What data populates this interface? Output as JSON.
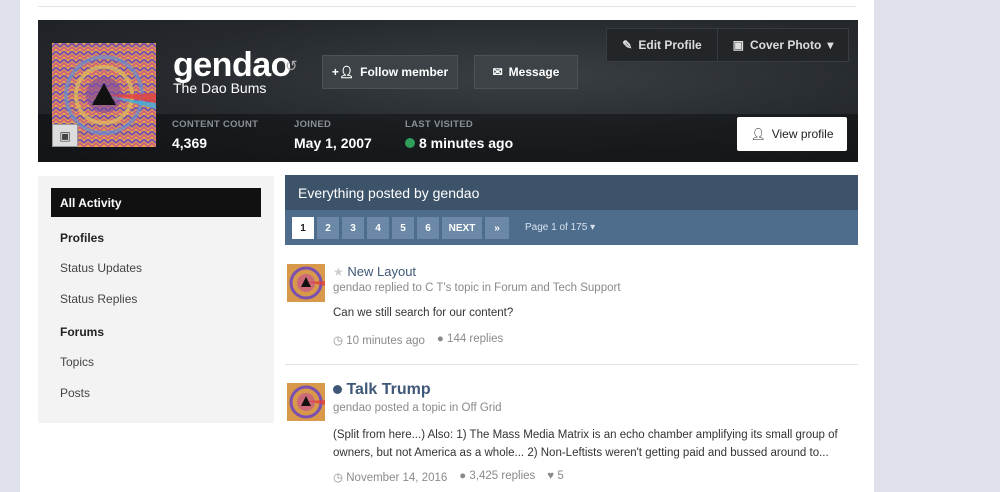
{
  "profile": {
    "username": "gendao",
    "group": "The Dao Bums",
    "follow_label": "Follow member",
    "message_label": "Message",
    "edit_profile_label": "Edit Profile",
    "cover_photo_label": "Cover Photo",
    "view_profile_label": "View profile",
    "stats": [
      {
        "label": "CONTENT COUNT",
        "value": "4,369"
      },
      {
        "label": "JOINED",
        "value": "May 1, 2007"
      },
      {
        "label": "LAST VISITED",
        "value": "8 minutes ago"
      }
    ]
  },
  "sidebar": {
    "active": "All Activity",
    "profiles_heading": "Profiles",
    "profiles_items": [
      "Status Updates",
      "Status Replies"
    ],
    "forums_heading": "Forums",
    "forums_items": [
      "Topics",
      "Posts"
    ]
  },
  "feed": {
    "title": "Everything posted by gendao",
    "pages": [
      "1",
      "2",
      "3",
      "4",
      "5",
      "6"
    ],
    "next_label": "NEXT",
    "last_label": "»",
    "page_of": "Page 1 of 175",
    "entries": [
      {
        "title": "New Layout",
        "meta": "gendao replied to C T's topic in Forum and Tech Support",
        "snippet": "Can we still search for our content?",
        "time": "10 minutes ago",
        "replies": "144 replies"
      },
      {
        "title": "Talk Trump",
        "meta": "gendao posted a topic in Off Grid",
        "snippet": "(Split from here...) Also: 1) The Mass Media Matrix is an echo chamber amplifying its small group of owners, but not America as a whole... 2) Non-Leftists weren't getting paid and bussed around to...",
        "time": "November 14, 2016",
        "replies": "3,425 replies",
        "likes": "5"
      }
    ]
  },
  "colors": {
    "header_bg": "#25292d",
    "feed_title_bg": "#3d5369",
    "pagination_bg": "#4e6d8d",
    "link": "#3f5878",
    "online": "#2f9e5a"
  }
}
